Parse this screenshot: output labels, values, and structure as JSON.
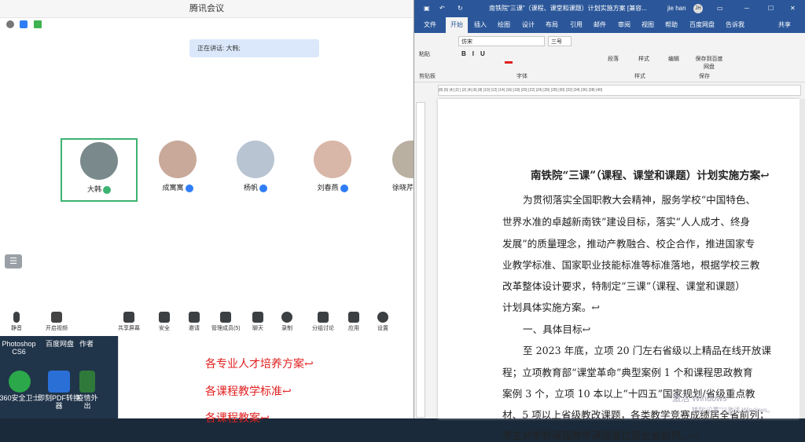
{
  "meeting": {
    "title": "腾讯会议",
    "speaking_label": "正在讲话: 大韩;",
    "participants": [
      {
        "name": "大韩"
      },
      {
        "name": "成寓寓"
      },
      {
        "name": "杨帆"
      },
      {
        "name": "刘春燕"
      },
      {
        "name": "徐晓芹"
      }
    ],
    "toolbar": {
      "mute": "静音",
      "video": "开启视频",
      "share": "共享屏幕",
      "security": "安全",
      "invite": "邀请",
      "members": "管理成员(5)",
      "chat": "聊天",
      "record": "录制",
      "breakout": "分组讨论",
      "apps": "应用",
      "settings": "设置"
    }
  },
  "desktop": {
    "icons": [
      {
        "label": "Photoshop CS6",
        "color": "#1f6fb0"
      },
      {
        "label": "百度网盘",
        "color": "#2f8cff"
      },
      {
        "label": "作者",
        "color": "#c04a2a"
      },
      {
        "label": "360安全卫士",
        "color": "#2ba84a"
      },
      {
        "label": "即刻PDF转换器",
        "color": "#2a6fd6"
      },
      {
        "label": "疫情外出",
        "color": "#2f7a3a"
      }
    ]
  },
  "doc_fragment": {
    "lines": [
      "各专业人才培养方案↩",
      "各课程教学标准↩",
      "各课程教案↩"
    ]
  },
  "word": {
    "title": "南铁院\"三课\"（课程、课堂和课题）计划实施方案 [兼容...",
    "user": "jie han",
    "user_initials": "JH",
    "tabs": [
      "文件",
      "开始",
      "插入",
      "绘图",
      "设计",
      "布局",
      "引用",
      "邮件",
      "审阅",
      "视图",
      "帮助",
      "百度网盘",
      "告诉我",
      "共享"
    ],
    "ribbon": {
      "paste": "粘贴",
      "font_name": "仿宋",
      "font_size": "三号",
      "paragraph": "段落",
      "styles": "样式",
      "editing": "编辑",
      "save_baidu": "保存到百度网盘",
      "groups": [
        "剪贴板",
        "字体",
        "样式",
        "保存"
      ]
    },
    "ruler_text": "|8| |6| |4| |2| | |2| |4| |6| |8| |10| |12| |14| |16| |18| |20| |22| |24| |26| |28| |30| |32| |34| |36| |38| |40|",
    "doc": {
      "title": "南铁院“三课”（课程、课堂和课题）计划实施方案↩",
      "para1": [
        "为贯彻落实全国职教大会精神，服务学校“中国特色、",
        "世界水准的卓越新南铁”建设目标，落实“人人成才、终身",
        "发展”的质量理念，推动产教融合、校企合作，推进国家专",
        "业教学标准、国家职业技能标准等标准落地，根据学校三教",
        "改革整体设计要求，特制定“三课”（课程、课堂和课题）",
        "计划具体实施方案。↩"
      ],
      "heading1": "一、具体目标↩",
      "para2": [
        "至 2023 年底，立项 20 门左右省级以上精品在线开放课",
        "程；立项教育部“课堂革命”典型案例 1 个和课程思政教育",
        "案例 3 个，立项 10 本以上“十四五”国家规划/省级重点教",
        "材、5 项以上省级教改课题，各类教学竞赛成绩居全省前列；",
        "学生对学校课程教学满意度位居全省前列。↩"
      ]
    },
    "activate": "激活 Windows",
    "activate_sub": "转到“设置”以激活 Windows。"
  }
}
